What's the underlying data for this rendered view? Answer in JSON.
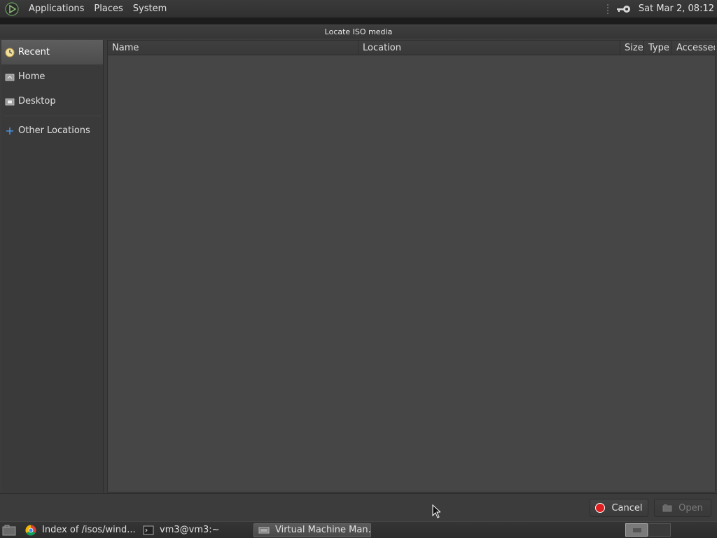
{
  "top_panel": {
    "menus": [
      "Applications",
      "Places",
      "System"
    ],
    "clock": "Sat Mar  2, 08:12"
  },
  "dialog": {
    "title": "Locate ISO media",
    "sidebar": {
      "items": [
        {
          "label": "Recent",
          "icon": "recent-clock-icon",
          "selected": true
        },
        {
          "label": "Home",
          "icon": "home-folder-icon",
          "selected": false
        },
        {
          "label": "Desktop",
          "icon": "desktop-folder-icon",
          "selected": false
        }
      ],
      "other": {
        "label": "Other Locations",
        "icon": "plus-icon"
      }
    },
    "columns": [
      "Name",
      "Location",
      "Size",
      "Type",
      "Accessed"
    ],
    "buttons": {
      "cancel": "Cancel",
      "open": "Open"
    }
  },
  "taskbar": {
    "tasks": [
      {
        "label": "Index of /isos/wind...",
        "icon": "chrome-icon",
        "active": false
      },
      {
        "label": "vm3@vm3:~",
        "icon": "terminal-icon",
        "active": false
      },
      {
        "label": "Virtual Machine Man...",
        "icon": "virt-manager-icon",
        "active": true
      }
    ]
  },
  "colors": {
    "accent_red": "#e02020",
    "plus_blue": "#4a90d9",
    "selected_bg": "#555555"
  }
}
